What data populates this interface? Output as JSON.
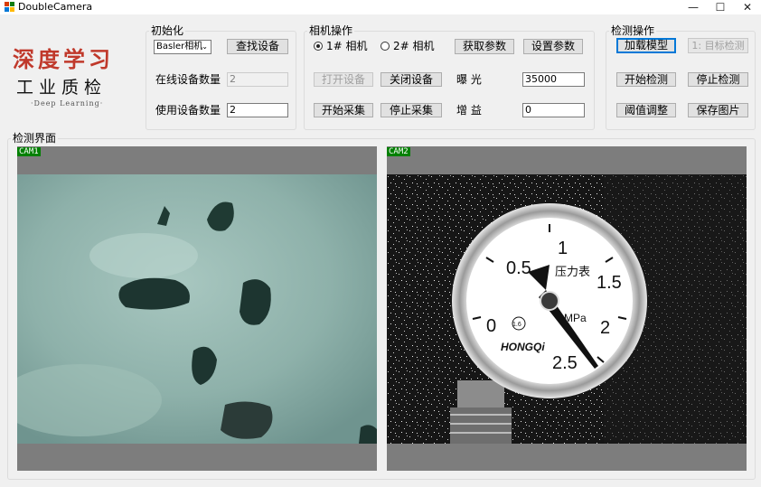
{
  "window": {
    "title": "DoubleCamera",
    "controls": {
      "minimize": "—",
      "maximize": "☐",
      "close": "✕"
    }
  },
  "logo": {
    "title": "深度学习",
    "subtitle": "工业质检",
    "tagline": "·Deep Learning·"
  },
  "init_group": {
    "label": "初始化",
    "camera_select": "Basler相机",
    "find_device_button": "查找设备",
    "online_count_label": "在线设备数量",
    "online_count_value": "2",
    "use_count_label": "使用设备数量",
    "use_count_value": "2"
  },
  "camera_group": {
    "label": "相机操作",
    "radio_cam1": "1# 相机",
    "radio_cam2": "2# 相机",
    "get_params_button": "获取参数",
    "set_params_button": "设置参数",
    "open_device_button": "打开设备",
    "close_device_button": "关闭设备",
    "exposure_label": "曝  光",
    "exposure_value": "35000",
    "start_capture_button": "开始采集",
    "stop_capture_button": "停止采集",
    "gain_label": "增  益",
    "gain_value": "0"
  },
  "detect_group": {
    "label": "检测操作",
    "load_model_button": "加载模型",
    "target_detect_button": "1: 目标检测",
    "start_detect_button": "开始检测",
    "stop_detect_button": "停止检测",
    "threshold_button": "阈值调整",
    "save_image_button": "保存图片"
  },
  "view_group": {
    "label": "检测界面",
    "cam1_tag": "CAM1",
    "cam2_tag": "CAM2"
  },
  "gauge": {
    "brand": "HONGQi",
    "title": "压力表",
    "unit": "MPa",
    "scale": [
      "0",
      "0.5",
      "1",
      "1.5",
      "2",
      "2.5"
    ],
    "class_badge": "1.6"
  }
}
